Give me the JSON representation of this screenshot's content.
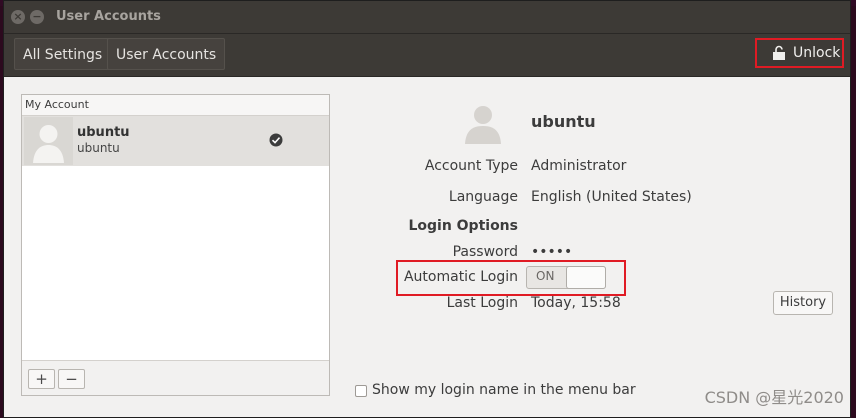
{
  "window": {
    "title": "User Accounts",
    "close_glyph": "×",
    "minimize_glyph": "−"
  },
  "toolbar": {
    "crumbs": [
      "All Settings",
      "User Accounts"
    ],
    "unlock_label": "Unlock"
  },
  "user_list": {
    "header": "My Account",
    "users": [
      {
        "name": "ubuntu",
        "username": "ubuntu",
        "active": true
      }
    ],
    "add_label": "+",
    "remove_label": "−"
  },
  "details": {
    "user_name": "ubuntu",
    "account_type_label": "Account Type",
    "account_type_value": "Administrator",
    "language_label": "Language",
    "language_value": "English (United States)",
    "login_options_label": "Login Options",
    "password_label": "Password",
    "password_value": "•••••",
    "automatic_login_label": "Automatic Login",
    "automatic_login_state": "ON",
    "last_login_label": "Last Login",
    "last_login_value": "Today, 15:58",
    "history_label": "History",
    "show_login_name_label": "Show my login name in the menu bar"
  },
  "watermark": "CSDN @星光2020",
  "colors": {
    "highlight_box": "#e01b24",
    "header_bg": "#3d3a36",
    "window_bg": "#f2f1f0"
  },
  "icons": [
    "lock-icon",
    "avatar-icon",
    "check-icon"
  ]
}
